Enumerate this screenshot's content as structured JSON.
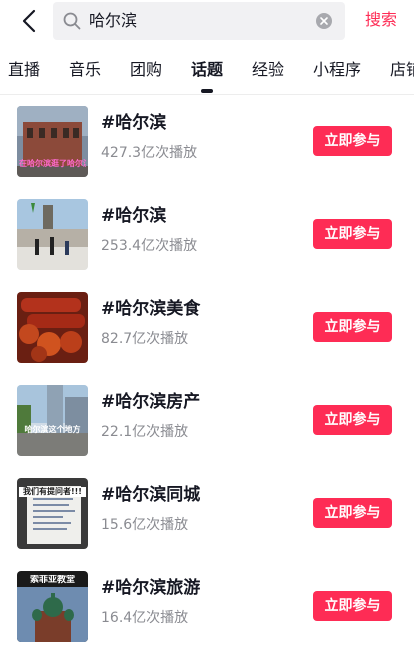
{
  "search": {
    "query": "哈尔滨",
    "button_label": "搜索"
  },
  "tabs": [
    {
      "label": "直播",
      "active": false
    },
    {
      "label": "音乐",
      "active": false
    },
    {
      "label": "团购",
      "active": false
    },
    {
      "label": "话题",
      "active": true
    },
    {
      "label": "经验",
      "active": false
    },
    {
      "label": "小程序",
      "active": false
    },
    {
      "label": "店铺",
      "active": false
    }
  ],
  "topics": [
    {
      "title": "#哈尔滨",
      "plays": "427.3亿次播放",
      "button": "立即参与",
      "thumb_caption": "在哈尔滨逛了哈尔滨的冰"
    },
    {
      "title": "#哈尔滨",
      "plays": "253.4亿次播放",
      "button": "立即参与",
      "thumb_caption": ""
    },
    {
      "title": "#哈尔滨美食",
      "plays": "82.7亿次播放",
      "button": "立即参与",
      "thumb_caption": ""
    },
    {
      "title": "#哈尔滨房产",
      "plays": "22.1亿次播放",
      "button": "立即参与",
      "thumb_caption": "哈尔滨这个地方"
    },
    {
      "title": "#哈尔滨同城",
      "plays": "15.6亿次播放",
      "button": "立即参与",
      "thumb_caption": "我们有提问者!!!"
    },
    {
      "title": "#哈尔滨旅游",
      "plays": "16.4亿次播放",
      "button": "立即参与",
      "thumb_caption": "索菲亚教堂"
    }
  ],
  "colors": {
    "accent": "#fe2c55",
    "text": "#161823",
    "secondary_text": "#8a8b91",
    "search_bg": "#f1f1f3"
  }
}
